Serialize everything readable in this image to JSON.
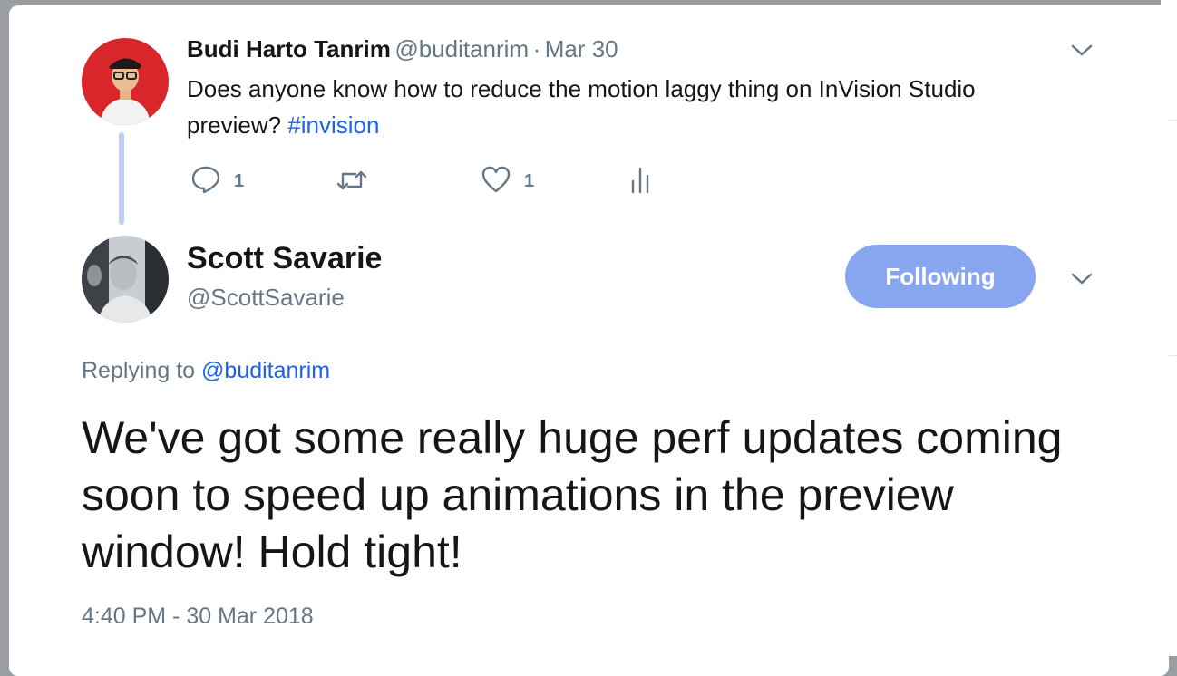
{
  "original_tweet": {
    "author_name": "Budi Harto Tanrim",
    "author_handle": "@buditanrim",
    "separator": "·",
    "date": "Mar 30",
    "text_before": "Does anyone know how to reduce the motion laggy thing on InVision Studio preview?",
    "hashtag": "#invision",
    "reply_count": "1",
    "like_count": "1",
    "icons": {
      "reply": "reply-icon",
      "retweet": "retweet-icon",
      "like": "heart-icon",
      "analytics": "analytics-icon",
      "menu": "chevron-down-icon"
    }
  },
  "reply_tweet": {
    "author_name": "Scott Savarie",
    "author_handle": "@ScottSavarie",
    "follow_label": "Following",
    "replying_to_prefix": "Replying to",
    "replying_to_handle": "@buditanrim",
    "text": "We've got some really huge perf updates coming soon to speed up animations in the preview window! Hold tight!",
    "timestamp": "4:40 PM - 30 Mar 2018"
  },
  "colors": {
    "link": "#1b62ef",
    "follow_button": "#88a6f0",
    "muted_text": "#657786",
    "thread_line": "#c4cff7"
  }
}
